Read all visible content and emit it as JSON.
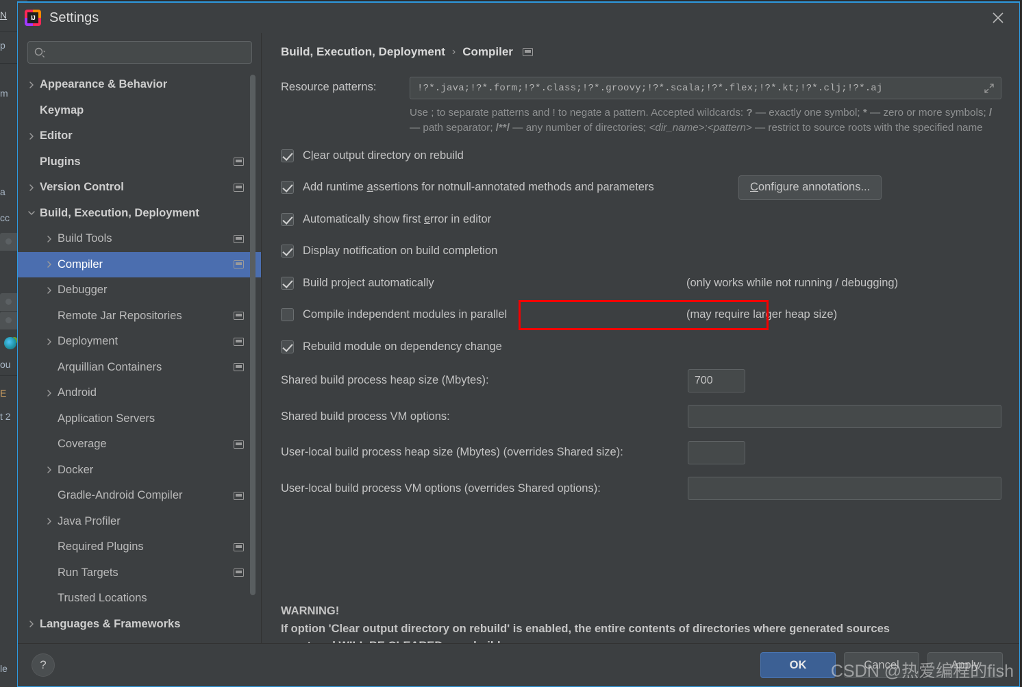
{
  "window": {
    "title": "Settings",
    "close_icon": "close-icon",
    "logo_text": "IJ"
  },
  "search": {
    "value": "",
    "placeholder": "",
    "icon": "search-icon"
  },
  "sidebar": {
    "items": [
      {
        "label": "Appearance & Behavior",
        "level": 0,
        "arrow": "chevron-right-icon",
        "monitor": false,
        "selected": false
      },
      {
        "label": "Keymap",
        "level": 0,
        "arrow": "",
        "monitor": false,
        "selected": false
      },
      {
        "label": "Editor",
        "level": 0,
        "arrow": "chevron-right-icon",
        "monitor": false,
        "selected": false
      },
      {
        "label": "Plugins",
        "level": 0,
        "arrow": "",
        "monitor": true,
        "selected": false
      },
      {
        "label": "Version Control",
        "level": 0,
        "arrow": "chevron-right-icon",
        "monitor": true,
        "selected": false
      },
      {
        "label": "Build, Execution, Deployment",
        "level": 0,
        "arrow": "chevron-down-icon",
        "monitor": false,
        "selected": false
      },
      {
        "label": "Build Tools",
        "level": 1,
        "arrow": "chevron-right-icon",
        "monitor": true,
        "selected": false
      },
      {
        "label": "Compiler",
        "level": 1,
        "arrow": "chevron-right-icon",
        "monitor": true,
        "selected": true
      },
      {
        "label": "Debugger",
        "level": 1,
        "arrow": "chevron-right-icon",
        "monitor": false,
        "selected": false
      },
      {
        "label": "Remote Jar Repositories",
        "level": 1,
        "arrow": "",
        "monitor": true,
        "selected": false
      },
      {
        "label": "Deployment",
        "level": 1,
        "arrow": "chevron-right-icon",
        "monitor": true,
        "selected": false
      },
      {
        "label": "Arquillian Containers",
        "level": 1,
        "arrow": "",
        "monitor": true,
        "selected": false
      },
      {
        "label": "Android",
        "level": 1,
        "arrow": "chevron-right-icon",
        "monitor": false,
        "selected": false
      },
      {
        "label": "Application Servers",
        "level": 1,
        "arrow": "",
        "monitor": false,
        "selected": false
      },
      {
        "label": "Coverage",
        "level": 1,
        "arrow": "",
        "monitor": true,
        "selected": false
      },
      {
        "label": "Docker",
        "level": 1,
        "arrow": "chevron-right-icon",
        "monitor": false,
        "selected": false
      },
      {
        "label": "Gradle-Android Compiler",
        "level": 1,
        "arrow": "",
        "monitor": true,
        "selected": false
      },
      {
        "label": "Java Profiler",
        "level": 1,
        "arrow": "chevron-right-icon",
        "monitor": false,
        "selected": false
      },
      {
        "label": "Required Plugins",
        "level": 1,
        "arrow": "",
        "monitor": true,
        "selected": false
      },
      {
        "label": "Run Targets",
        "level": 1,
        "arrow": "",
        "monitor": true,
        "selected": false
      },
      {
        "label": "Trusted Locations",
        "level": 1,
        "arrow": "",
        "monitor": false,
        "selected": false
      },
      {
        "label": "Languages & Frameworks",
        "level": 0,
        "arrow": "chevron-right-icon",
        "monitor": false,
        "selected": false
      }
    ]
  },
  "content": {
    "breadcrumb": {
      "parent": "Build, Execution, Deployment",
      "separator": "›",
      "current": "Compiler",
      "monitor_icon": "project-scope-icon"
    },
    "resource_patterns": {
      "label": "Resource patterns:",
      "value": "!?*.java;!?*.form;!?*.class;!?*.groovy;!?*.scala;!?*.flex;!?*.kt;!?*.clj;!?*.aj",
      "expand_icon": "expand-editor-icon",
      "help_line1_a": "Use ; to separate patterns and ! to negate a pattern. Accepted wildcards: ",
      "help_bold_1": "?",
      "help_line1_b": " — exactly one symbol; ",
      "help_bold_2": "*",
      "help_line1_c": " — zero or more symbols; ",
      "help_bold_3": "/",
      "help_line1_d": " — path separator; ",
      "help_bold_4": "/**/",
      "help_line1_e": " — any number of directories; ",
      "help_italic_1": "<dir_name>:<pattern>",
      "help_line1_f": " — restrict to source roots with the specified name"
    },
    "checkboxes": [
      {
        "label_pre": "C",
        "label_mnemonic": "l",
        "label_post": "ear output directory on rebuild",
        "checked": true
      },
      {
        "label_pre": "Add runtime ",
        "label_mnemonic": "a",
        "label_post": "ssertions for notnull-annotated methods and parameters",
        "checked": true
      },
      {
        "label_pre": "Automatically show first ",
        "label_mnemonic": "e",
        "label_post": "rror in editor",
        "checked": true
      },
      {
        "label_pre": "Display notification on build completion",
        "label_mnemonic": "",
        "label_post": "",
        "checked": true
      },
      {
        "label_pre": "Build project automatically",
        "label_mnemonic": "",
        "label_post": "",
        "checked": true
      },
      {
        "label_pre": "Compile independent modules in parallel",
        "label_mnemonic": "",
        "label_post": "",
        "checked": false
      },
      {
        "label_pre": "Rebuild module on dependency change",
        "label_mnemonic": "",
        "label_post": "",
        "checked": true
      }
    ],
    "configure_annotations": {
      "pre": "C",
      "mnemonic": "",
      "label": "Configure annotations..."
    },
    "notes": {
      "build_auto": "(only works while not running / debugging)",
      "parallel": "(may require larger heap size)"
    },
    "fields": [
      {
        "label": "Shared build process heap size (Mbytes):",
        "value": "700",
        "size": "small"
      },
      {
        "label": "Shared build process VM options:",
        "value": "",
        "size": "wide"
      },
      {
        "label": "User-local build process heap size (Mbytes) (overrides Shared size):",
        "value": "",
        "size": "small"
      },
      {
        "label": "User-local build process VM options (overrides Shared options):",
        "value": "",
        "size": "wide"
      }
    ],
    "warning": {
      "title": "WARNING!",
      "line1": "If option 'Clear output directory on rebuild' is enabled, the entire contents of directories where generated sources",
      "line2": "are stored WILL BE CLEARED on rebuild."
    }
  },
  "footer": {
    "help_label": "?",
    "ok_label": "OK",
    "cancel_label": "Cancel",
    "apply_label": "Apply"
  },
  "watermark": "CSDN @热爱编程的fish",
  "backdrop": {
    "menu_n": "N",
    "row_p": "p",
    "row_m": "m",
    "row_a": "a",
    "row_cc": "cc",
    "row_ou": "ou",
    "row_e": "E",
    "row_t2": "t 2",
    "row_le": "le"
  },
  "colors": {
    "accent_selection": "#4b6eaf",
    "dialog_bg": "#3c3f41",
    "field_bg": "#45494a",
    "border": "#5e6264",
    "text": "#c4c4c4",
    "annotation_red": "#f40000",
    "primary_button": "#3c6094",
    "window_border": "#2d9ae0"
  }
}
